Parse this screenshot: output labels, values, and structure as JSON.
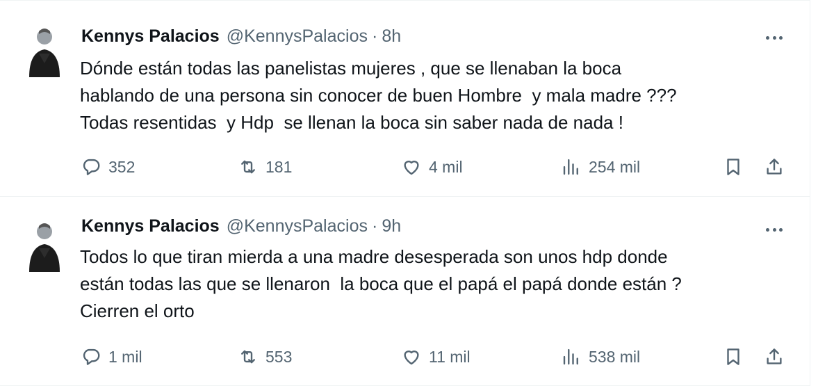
{
  "tweets": [
    {
      "author": {
        "name": "Kennys Palacios",
        "handle": "@KennysPalacios"
      },
      "separator": "·",
      "time": "8h",
      "text": "Dónde están todas las panelistas mujeres , que se llenaban la boca\nhablando de una persona sin conocer de buen Hombre  y mala madre ???\nTodas resentidas  y Hdp  se llenan la boca sin saber nada de nada !",
      "stats": {
        "replies": "352",
        "reposts": "181",
        "likes": "4 mil",
        "views": "254 mil"
      }
    },
    {
      "author": {
        "name": "Kennys Palacios",
        "handle": "@KennysPalacios"
      },
      "separator": "·",
      "time": "9h",
      "text": "Todos lo que tiran mierda a una madre desesperada son unos hdp donde\nestán todas las que se llenaron  la boca que el papá el papá donde están ?\nCierren el orto",
      "stats": {
        "replies": "1 mil",
        "reposts": "553",
        "likes": "11 mil",
        "views": "538 mil"
      }
    }
  ],
  "icons": {
    "reply": "reply-icon",
    "repost": "repost-icon",
    "like": "heart-icon",
    "views": "views-chart-icon",
    "bookmark": "bookmark-icon",
    "share": "share-icon",
    "more": "more-icon"
  }
}
